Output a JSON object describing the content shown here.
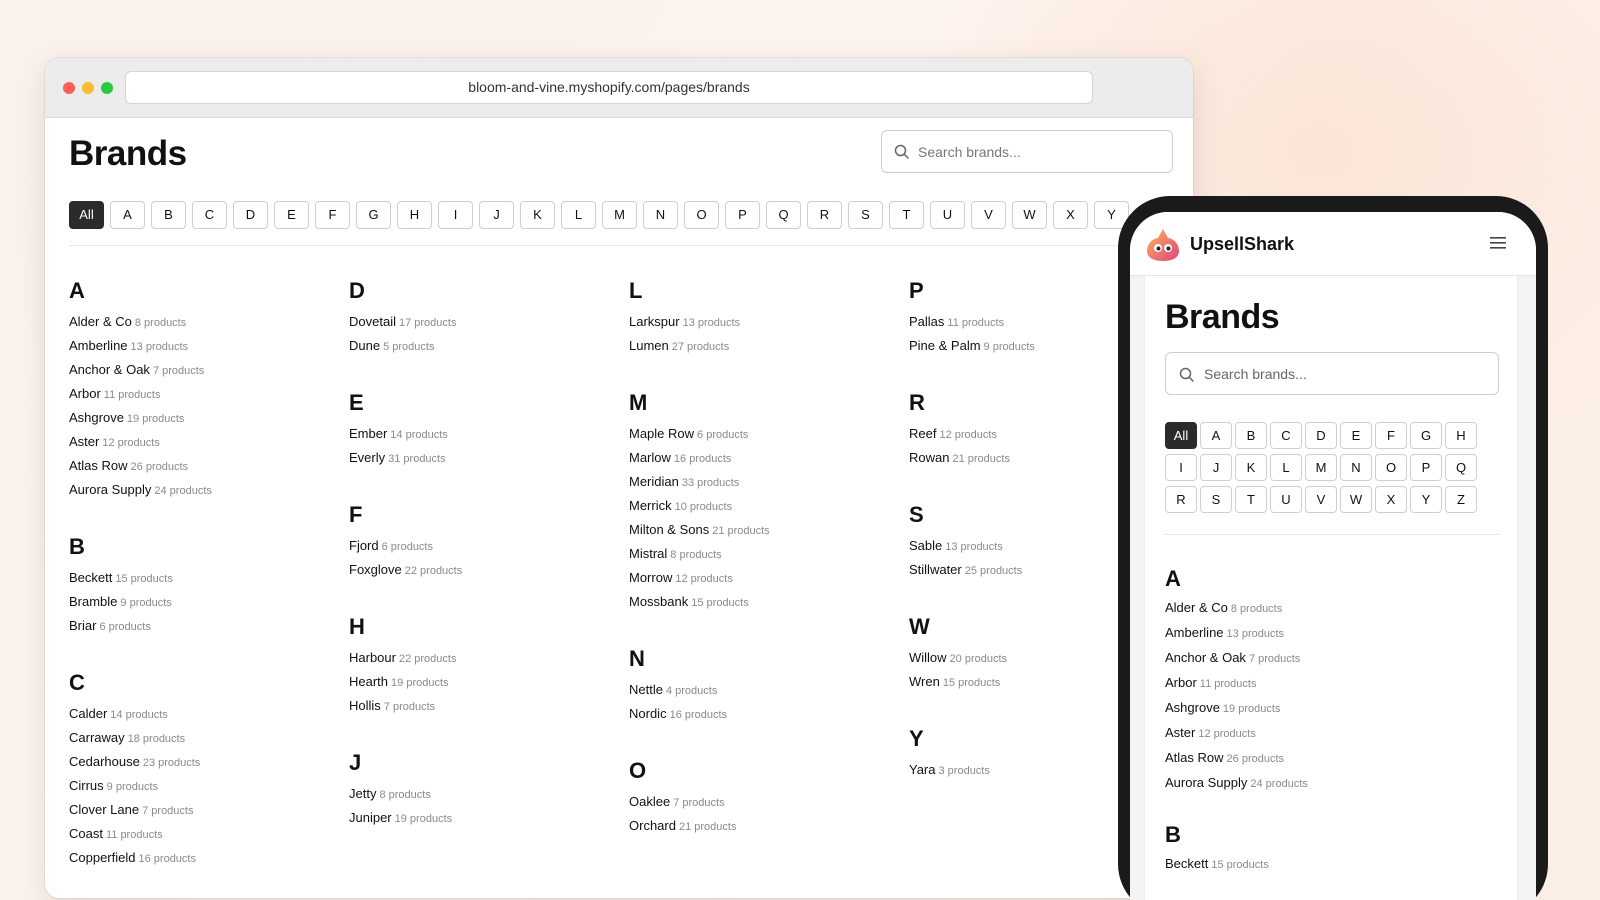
{
  "browser": {
    "url": "bloom-and-vine.myshopify.com/pages/brands",
    "title": "Brands",
    "search_placeholder": "Search brands...",
    "letters": [
      "All",
      "A",
      "B",
      "C",
      "D",
      "E",
      "F",
      "G",
      "H",
      "I",
      "J",
      "K",
      "L",
      "M",
      "N",
      "O",
      "P",
      "Q",
      "R",
      "S",
      "T",
      "U",
      "V",
      "W",
      "X",
      "Y"
    ],
    "active_letter": "All",
    "columns": [
      [
        {
          "letter": "A",
          "brands": [
            [
              "Alder & Co",
              "8 products"
            ],
            [
              "Amberline",
              "13 products"
            ],
            [
              "Anchor & Oak",
              "7 products"
            ],
            [
              "Arbor",
              "11 products"
            ],
            [
              "Ashgrove",
              "19 products"
            ],
            [
              "Aster",
              "12 products"
            ],
            [
              "Atlas Row",
              "26 products"
            ],
            [
              "Aurora Supply",
              "24 products"
            ]
          ]
        },
        {
          "letter": "B",
          "brands": [
            [
              "Beckett",
              "15 products"
            ],
            [
              "Bramble",
              "9 products"
            ],
            [
              "Briar",
              "6 products"
            ]
          ]
        },
        {
          "letter": "C",
          "brands": [
            [
              "Calder",
              "14 products"
            ],
            [
              "Carraway",
              "18 products"
            ],
            [
              "Cedarhouse",
              "23 products"
            ],
            [
              "Cirrus",
              "9 products"
            ],
            [
              "Clover Lane",
              "7 products"
            ],
            [
              "Coast",
              "11 products"
            ],
            [
              "Copperfield",
              "16 products"
            ]
          ]
        }
      ],
      [
        {
          "letter": "D",
          "brands": [
            [
              "Dovetail",
              "17 products"
            ],
            [
              "Dune",
              "5 products"
            ]
          ]
        },
        {
          "letter": "E",
          "brands": [
            [
              "Ember",
              "14 products"
            ],
            [
              "Everly",
              "31 products"
            ]
          ]
        },
        {
          "letter": "F",
          "brands": [
            [
              "Fjord",
              "6 products"
            ],
            [
              "Foxglove",
              "22 products"
            ]
          ]
        },
        {
          "letter": "H",
          "brands": [
            [
              "Harbour",
              "22 products"
            ],
            [
              "Hearth",
              "19 products"
            ],
            [
              "Hollis",
              "7 products"
            ]
          ]
        },
        {
          "letter": "J",
          "brands": [
            [
              "Jetty",
              "8 products"
            ],
            [
              "Juniper",
              "19 products"
            ]
          ]
        }
      ],
      [
        {
          "letter": "L",
          "brands": [
            [
              "Larkspur",
              "13 products"
            ],
            [
              "Lumen",
              "27 products"
            ]
          ]
        },
        {
          "letter": "M",
          "brands": [
            [
              "Maple Row",
              "6 products"
            ],
            [
              "Marlow",
              "16 products"
            ],
            [
              "Meridian",
              "33 products"
            ],
            [
              "Merrick",
              "10 products"
            ],
            [
              "Milton & Sons",
              "21 products"
            ],
            [
              "Mistral",
              "8 products"
            ],
            [
              "Morrow",
              "12 products"
            ],
            [
              "Mossbank",
              "15 products"
            ]
          ]
        },
        {
          "letter": "N",
          "brands": [
            [
              "Nettle",
              "4 products"
            ],
            [
              "Nordic",
              "16 products"
            ]
          ]
        },
        {
          "letter": "O",
          "brands": [
            [
              "Oaklee",
              "7 products"
            ],
            [
              "Orchard",
              "21 products"
            ]
          ]
        }
      ],
      [
        {
          "letter": "P",
          "brands": [
            [
              "Pallas",
              "11 products"
            ],
            [
              "Pine & Palm",
              "9 products"
            ]
          ]
        },
        {
          "letter": "R",
          "brands": [
            [
              "Reef",
              "12 products"
            ],
            [
              "Rowan",
              "21 products"
            ]
          ]
        },
        {
          "letter": "S",
          "brands": [
            [
              "Sable",
              "13 products"
            ],
            [
              "Stillwater",
              "25 products"
            ]
          ]
        },
        {
          "letter": "W",
          "brands": [
            [
              "Willow",
              "20 products"
            ],
            [
              "Wren",
              "15 products"
            ]
          ]
        },
        {
          "letter": "Y",
          "brands": [
            [
              "Yara",
              "3 products"
            ]
          ]
        }
      ]
    ]
  },
  "phone": {
    "app_name": "UpsellShark",
    "title": "Brands",
    "search_placeholder": "Search brands...",
    "letters": [
      "All",
      "A",
      "B",
      "C",
      "D",
      "E",
      "F",
      "G",
      "H",
      "I",
      "J",
      "K",
      "L",
      "M",
      "N",
      "O",
      "P",
      "Q",
      "R",
      "S",
      "T",
      "U",
      "V",
      "W",
      "X",
      "Y",
      "Z"
    ],
    "active_letter": "All",
    "groups": [
      {
        "letter": "A",
        "brands": [
          [
            "Alder & Co",
            "8 products"
          ],
          [
            "Amberline",
            "13 products"
          ],
          [
            "Anchor & Oak",
            "7 products"
          ],
          [
            "Arbor",
            "11 products"
          ],
          [
            "Ashgrove",
            "19 products"
          ],
          [
            "Aster",
            "12 products"
          ],
          [
            "Atlas Row",
            "26 products"
          ],
          [
            "Aurora Supply",
            "24 products"
          ]
        ]
      },
      {
        "letter": "B",
        "brands": [
          [
            "Beckett",
            "15 products"
          ]
        ]
      }
    ]
  },
  "colors": {
    "accent_dark": "#2b2b2b",
    "muted_text": "#8a8a8a"
  }
}
